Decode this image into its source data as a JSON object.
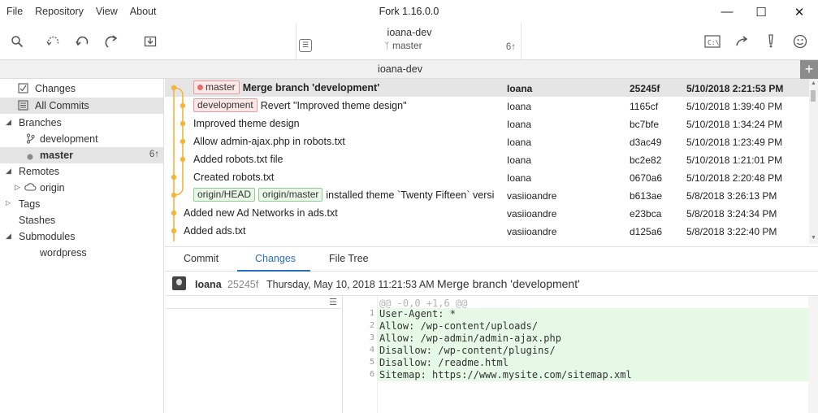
{
  "menu": [
    "File",
    "Repository",
    "View",
    "About"
  ],
  "app_title": "Fork 1.16.0.0",
  "repo": {
    "name": "ioana-dev",
    "branch": "master",
    "ahead": "6↑"
  },
  "tab_title": "ioana-dev",
  "sidebar": {
    "changes": "Changes",
    "all_commits": "All Commits",
    "branches": "Branches",
    "branch_items": [
      {
        "label": "development",
        "count": ""
      },
      {
        "label": "master",
        "count": "6↑"
      }
    ],
    "remotes": "Remotes",
    "remote_items": [
      "origin"
    ],
    "tags": "Tags",
    "stashes": "Stashes",
    "submodules": "Submodules",
    "submodule_items": [
      "wordpress"
    ]
  },
  "commits": [
    {
      "tags": [
        "master"
      ],
      "message": "Merge branch 'development'",
      "author": "Ioana",
      "sha": "25245f",
      "date": "5/10/2018 2:21:53 PM"
    },
    {
      "tags": [
        "development"
      ],
      "message": "Revert \"Improved theme design\"",
      "author": "Ioana",
      "sha": "1165cf",
      "date": "5/10/2018 1:39:40 PM"
    },
    {
      "tags": [],
      "message": "Improved theme design",
      "author": "Ioana",
      "sha": "bc7bfe",
      "date": "5/10/2018 1:34:24 PM"
    },
    {
      "tags": [],
      "message": "Allow admin-ajax.php in robots.txt",
      "author": "Ioana",
      "sha": "d3ac49",
      "date": "5/10/2018 1:23:49 PM"
    },
    {
      "tags": [],
      "message": "Added robots.txt file",
      "author": "Ioana",
      "sha": "bc2e82",
      "date": "5/10/2018 1:21:01 PM"
    },
    {
      "tags": [],
      "message": "Created robots.txt",
      "author": "Ioana",
      "sha": "0670a6",
      "date": "5/10/2018 2:20:48 PM"
    },
    {
      "tags": [
        "origin/HEAD",
        "origin/master"
      ],
      "message": "installed theme `Twenty Fifteen` version",
      "author": "vasiioandre",
      "sha": "b613ae",
      "date": "5/8/2018 3:26:13 PM"
    },
    {
      "tags": [],
      "message": "Added new Ad Networks in ads.txt",
      "author": "vasiioandre",
      "sha": "e23bca",
      "date": "5/8/2018 3:24:34 PM"
    },
    {
      "tags": [],
      "message": "Added ads.txt",
      "author": "vasiioandre",
      "sha": "d125a6",
      "date": "5/8/2018 3:22:40 PM"
    }
  ],
  "detail_tabs": [
    "Commit",
    "Changes",
    "File Tree"
  ],
  "commit_detail": {
    "author": "Ioana",
    "sha": "25245f",
    "date": "Thursday, May 10, 2018 11:21:53 AM",
    "message": "Merge branch 'development'"
  },
  "diff": {
    "hunk": "@@ -0,0 +1,6 @@",
    "lines": [
      {
        "n": "1",
        "text": "User-Agent: *"
      },
      {
        "n": "2",
        "text": "Allow: /wp-content/uploads/"
      },
      {
        "n": "3",
        "text": "Allow: /wp-admin/admin-ajax.php"
      },
      {
        "n": "4",
        "text": "Disallow: /wp-content/plugins/"
      },
      {
        "n": "5",
        "text": "Disallow: /readme.html"
      },
      {
        "n": "6",
        "text": "Sitemap: https://www.mysite.com/sitemap.xml"
      }
    ]
  },
  "colors": {
    "graph": "#f2b63c",
    "accent": "#2a6fc0",
    "tag_local": "#fde8e8",
    "tag_remote": "#e8f7e8"
  }
}
